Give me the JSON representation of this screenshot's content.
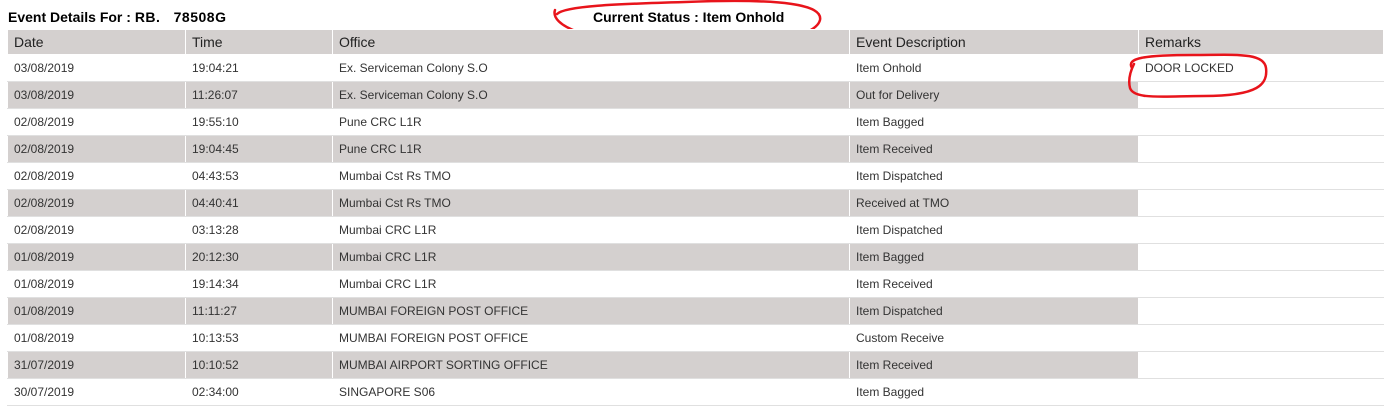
{
  "header": {
    "event_details_label": "Event Details For :",
    "tracking_number": "RB.    78508G",
    "current_status": "Current Status : Item Onhold"
  },
  "table": {
    "columns": [
      "Date",
      "Time",
      "Office",
      "Event Description",
      "Remarks"
    ],
    "rows": [
      {
        "date": "03/08/2019",
        "time": "19:04:21",
        "office": "Ex. Serviceman Colony S.O",
        "event": "Item Onhold",
        "remarks": "DOOR LOCKED"
      },
      {
        "date": "03/08/2019",
        "time": "11:26:07",
        "office": "Ex. Serviceman Colony S.O",
        "event": "Out for Delivery",
        "remarks": ""
      },
      {
        "date": "02/08/2019",
        "time": "19:55:10",
        "office": "Pune CRC L1R",
        "event": "Item Bagged",
        "remarks": ""
      },
      {
        "date": "02/08/2019",
        "time": "19:04:45",
        "office": "Pune CRC L1R",
        "event": "Item Received",
        "remarks": ""
      },
      {
        "date": "02/08/2019",
        "time": "04:43:53",
        "office": "Mumbai Cst Rs TMO",
        "event": "Item Dispatched",
        "remarks": ""
      },
      {
        "date": "02/08/2019",
        "time": "04:40:41",
        "office": "Mumbai Cst Rs TMO",
        "event": "Received at TMO",
        "remarks": ""
      },
      {
        "date": "02/08/2019",
        "time": "03:13:28",
        "office": "Mumbai CRC L1R",
        "event": "Item Dispatched",
        "remarks": ""
      },
      {
        "date": "01/08/2019",
        "time": "20:12:30",
        "office": "Mumbai CRC L1R",
        "event": "Item Bagged",
        "remarks": ""
      },
      {
        "date": "01/08/2019",
        "time": "19:14:34",
        "office": "Mumbai CRC L1R",
        "event": "Item Received",
        "remarks": ""
      },
      {
        "date": "01/08/2019",
        "time": "11:11:27",
        "office": "MUMBAI FOREIGN POST OFFICE",
        "event": "Item Dispatched",
        "remarks": ""
      },
      {
        "date": "01/08/2019",
        "time": "10:13:53",
        "office": "MUMBAI FOREIGN POST OFFICE",
        "event": "Custom Receive",
        "remarks": ""
      },
      {
        "date": "31/07/2019",
        "time": "10:10:52",
        "office": "MUMBAI AIRPORT SORTING OFFICE",
        "event": "Item Received",
        "remarks": ""
      },
      {
        "date": "30/07/2019",
        "time": "02:34:00",
        "office": "SINGAPORE S06",
        "event": "Item Bagged",
        "remarks": ""
      }
    ]
  },
  "colors": {
    "header_bg": "#d4d0cf",
    "row_alt_bg": "#d4d0cf",
    "annotation_red": "#e8141b"
  }
}
